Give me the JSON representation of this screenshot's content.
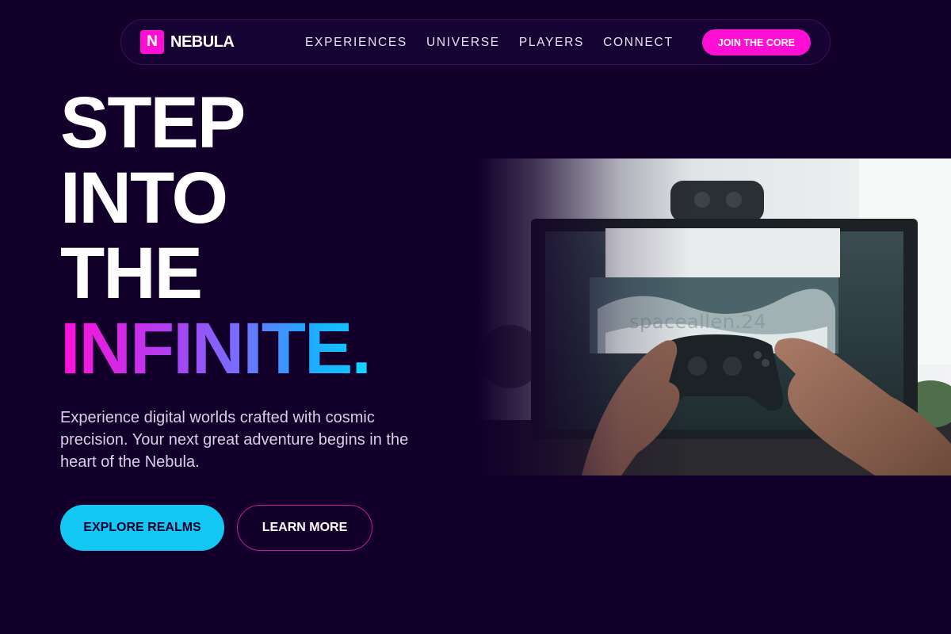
{
  "brand": {
    "mark": "N",
    "name": "NEBULA",
    "accent": "#ff0fd4"
  },
  "nav": {
    "links": [
      "EXPERIENCES",
      "UNIVERSE",
      "PLAYERS",
      "CONNECT"
    ],
    "cta": "JOIN THE CORE"
  },
  "hero": {
    "lines": [
      "STEP",
      "INTO",
      "THE"
    ],
    "highlight": "INFINITE",
    "highlight_dot": ".",
    "lede": "Experience digital worlds crafted with cosmic precision. Your next great adventure begins in the heart of the Nebula.",
    "primary_button": "EXPLORE REALMS",
    "secondary_button": "LEARN MORE"
  },
  "image": {
    "watermark": "spaceallen.24",
    "subject": "hands holding game controller in front of monitor"
  },
  "colors": {
    "background": "#13002a",
    "primary": "#12c8f2",
    "pink": "#ff0fd4",
    "gradient": [
      "#ff10d8",
      "#7a6cff",
      "#12c3ff"
    ]
  }
}
